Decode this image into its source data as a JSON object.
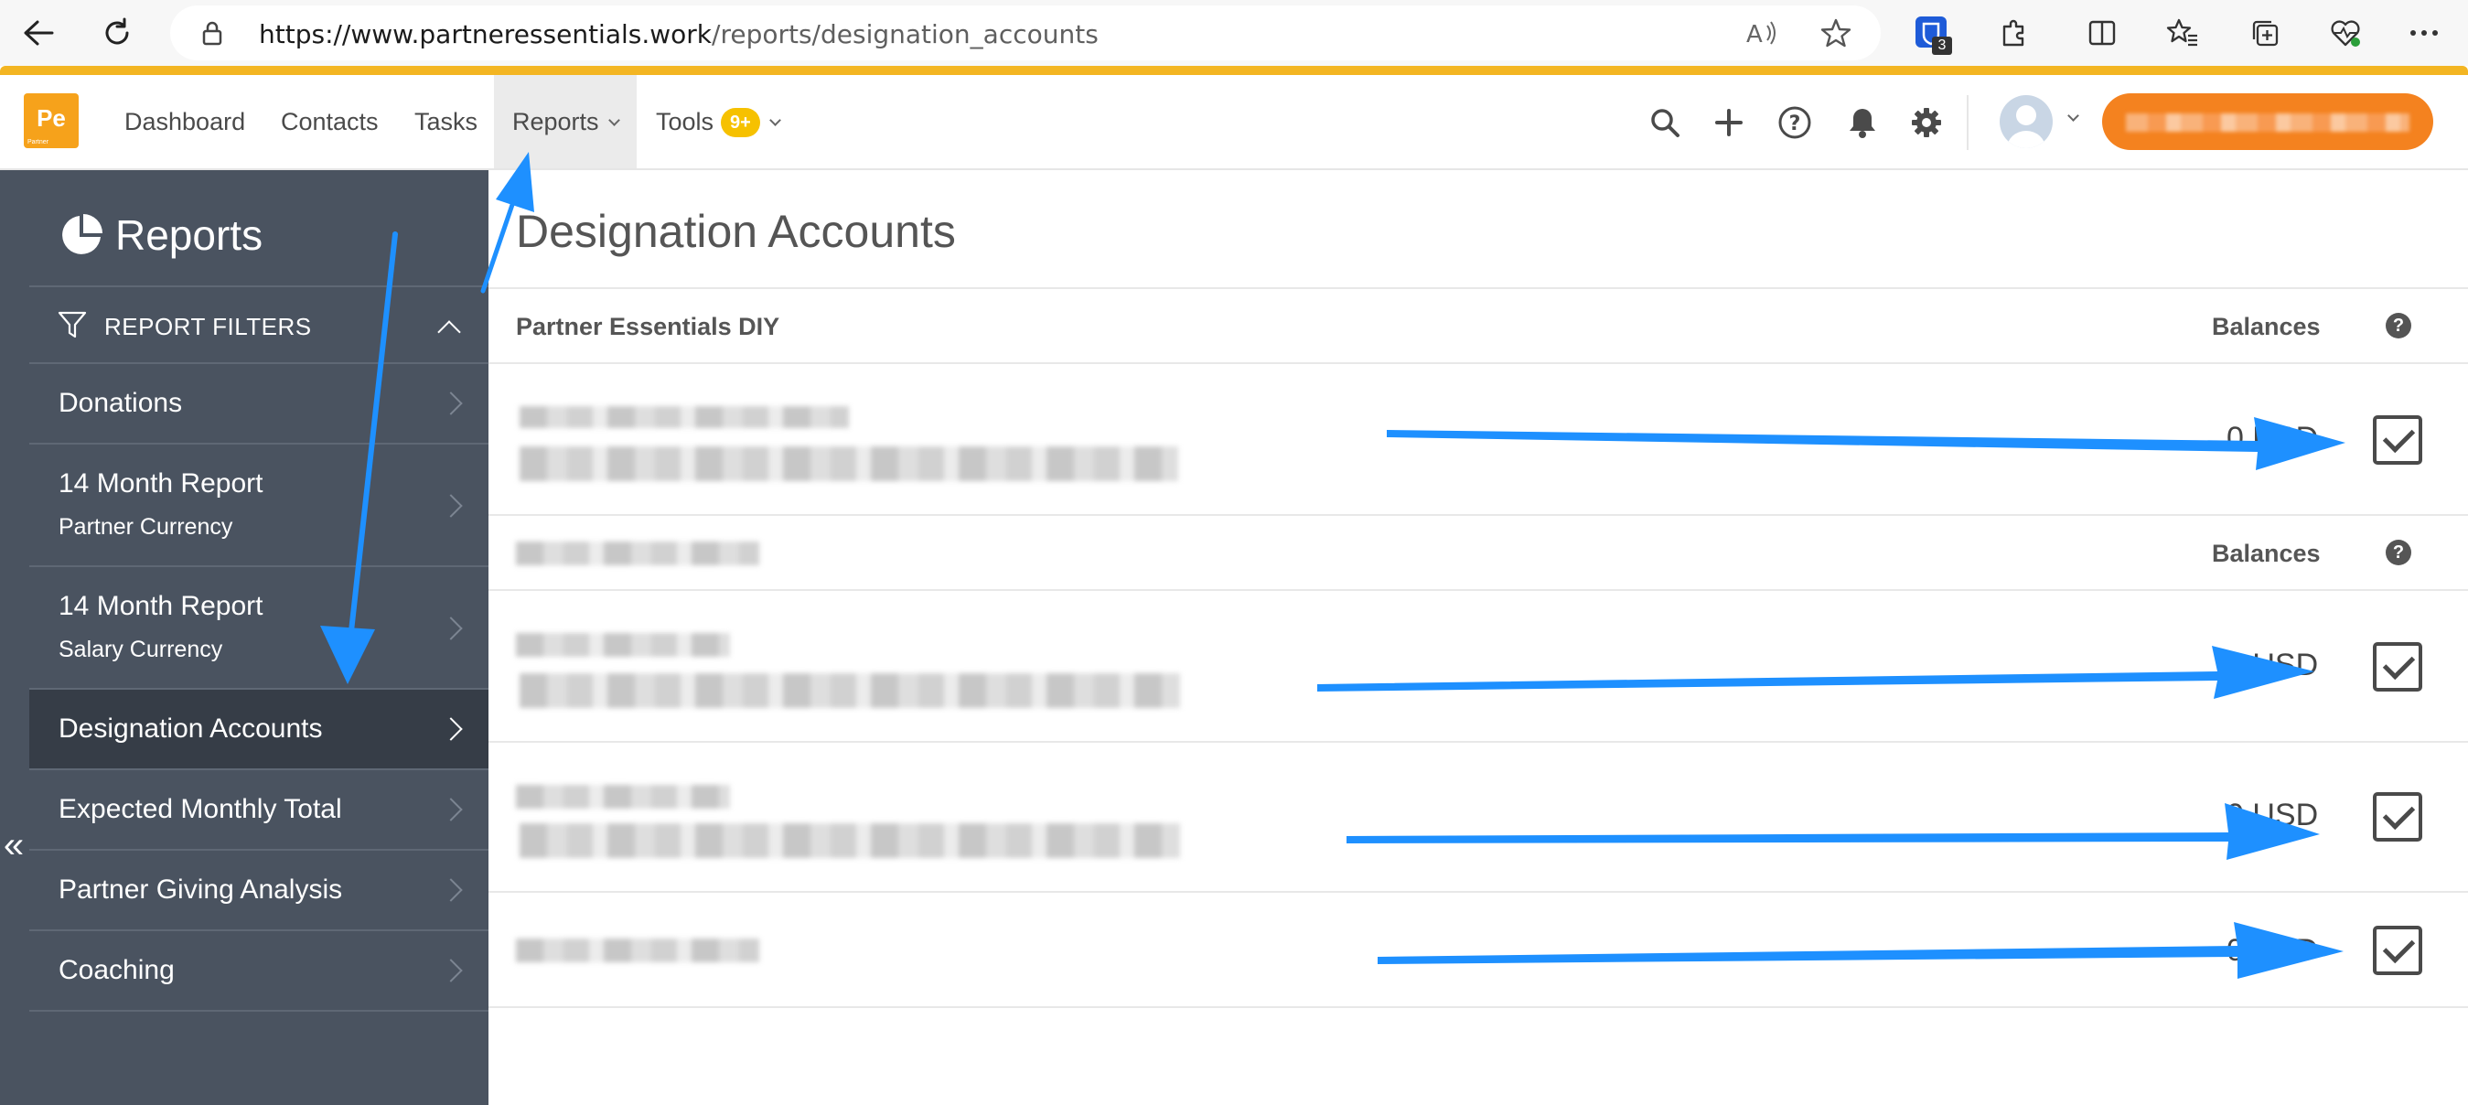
{
  "browser": {
    "url_host": "https://www.partneressentials.work",
    "url_path": "/reports/designation_accounts",
    "extension_badge": "3",
    "icons": [
      "back-icon",
      "refresh-icon",
      "lock-icon",
      "read-aloud-icon",
      "favorite-star-icon",
      "extensions-icon",
      "split-screen-icon",
      "favorites-icon",
      "collections-icon",
      "health-icon",
      "more-icon"
    ]
  },
  "app": {
    "logo_text": "Pe",
    "logo_subtext": "Partner",
    "nav": {
      "dashboard": "Dashboard",
      "contacts": "Contacts",
      "tasks": "Tasks",
      "reports": "Reports",
      "tools": "Tools",
      "tools_badge": "9+"
    },
    "colors": {
      "accent_orange": "#f6a21b",
      "browser_stripe": "#f3b522",
      "sidebar": "#4a5360",
      "sidebar_active": "#363d47",
      "annotation_arrow": "#1e90ff"
    }
  },
  "sidebar": {
    "title": "Reports",
    "filters_label": "REPORT FILTERS",
    "collapse_glyph": "«",
    "items": [
      {
        "label": "Donations",
        "sublabel": ""
      },
      {
        "label": "14 Month Report",
        "sublabel": "Partner Currency"
      },
      {
        "label": "14 Month Report",
        "sublabel": "Salary Currency"
      },
      {
        "label": "Designation Accounts",
        "sublabel": "",
        "active": true
      },
      {
        "label": "Expected Monthly Total",
        "sublabel": ""
      },
      {
        "label": "Partner Giving Analysis",
        "sublabel": ""
      },
      {
        "label": "Coaching",
        "sublabel": ""
      }
    ]
  },
  "main": {
    "title": "Designation Accounts",
    "sections": [
      {
        "name": "Partner Essentials DIY",
        "balances_label": "Balances",
        "help_glyph": "?",
        "rows": [
          {
            "balance": "0 USD",
            "checked": true
          }
        ]
      },
      {
        "name": "",
        "balances_label": "Balances",
        "help_glyph": "?",
        "rows": [
          {
            "balance": "0 USD",
            "checked": true
          },
          {
            "balance": "0 USD",
            "checked": true
          },
          {
            "balance": "0 USD",
            "checked": true
          }
        ]
      }
    ]
  }
}
